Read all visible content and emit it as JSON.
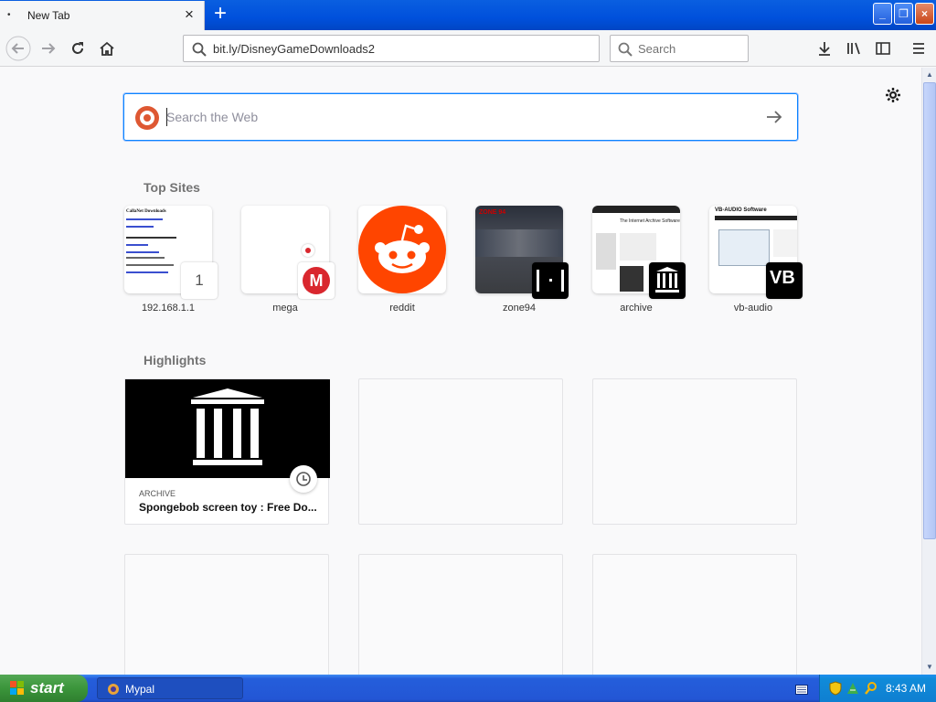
{
  "tab": {
    "title": "New Tab",
    "close": "×",
    "dot": "•"
  },
  "newtab_label": "+",
  "window_controls": {
    "minimize": "_",
    "maximize": "❐",
    "close": "×"
  },
  "urlbar": {
    "value": "bit.ly/DisneyGameDownloads2"
  },
  "searchbar": {
    "placeholder": "Search"
  },
  "websearch": {
    "placeholder": "Search the Web"
  },
  "top_sites": {
    "title": "Top Sites",
    "items": [
      {
        "label": "192.168.1.1",
        "badge": "1"
      },
      {
        "label": "mega"
      },
      {
        "label": "reddit"
      },
      {
        "label": "zone94"
      },
      {
        "label": "archive"
      },
      {
        "label": "vb-audio"
      }
    ]
  },
  "site_thumb_text": {
    "callnet": "CallaNet Downloads",
    "vb": "VB-AUDIO Software",
    "vb_badge": "VB",
    "archive_text": "The Internet Archive Software",
    "zone": "ZONE 94"
  },
  "highlights": {
    "title": "Highlights",
    "items": [
      {
        "source": "ARCHIVE",
        "title": "Spongebob screen toy : Free Do..."
      }
    ]
  },
  "taskbar": {
    "start_label": "start",
    "task_label": "Mypal",
    "clock": "8:43 AM"
  },
  "colors": {
    "accent": "#0a84ff",
    "reddit": "#ff4500",
    "mega": "#d9272e",
    "duckduckgo": "#de5833"
  }
}
